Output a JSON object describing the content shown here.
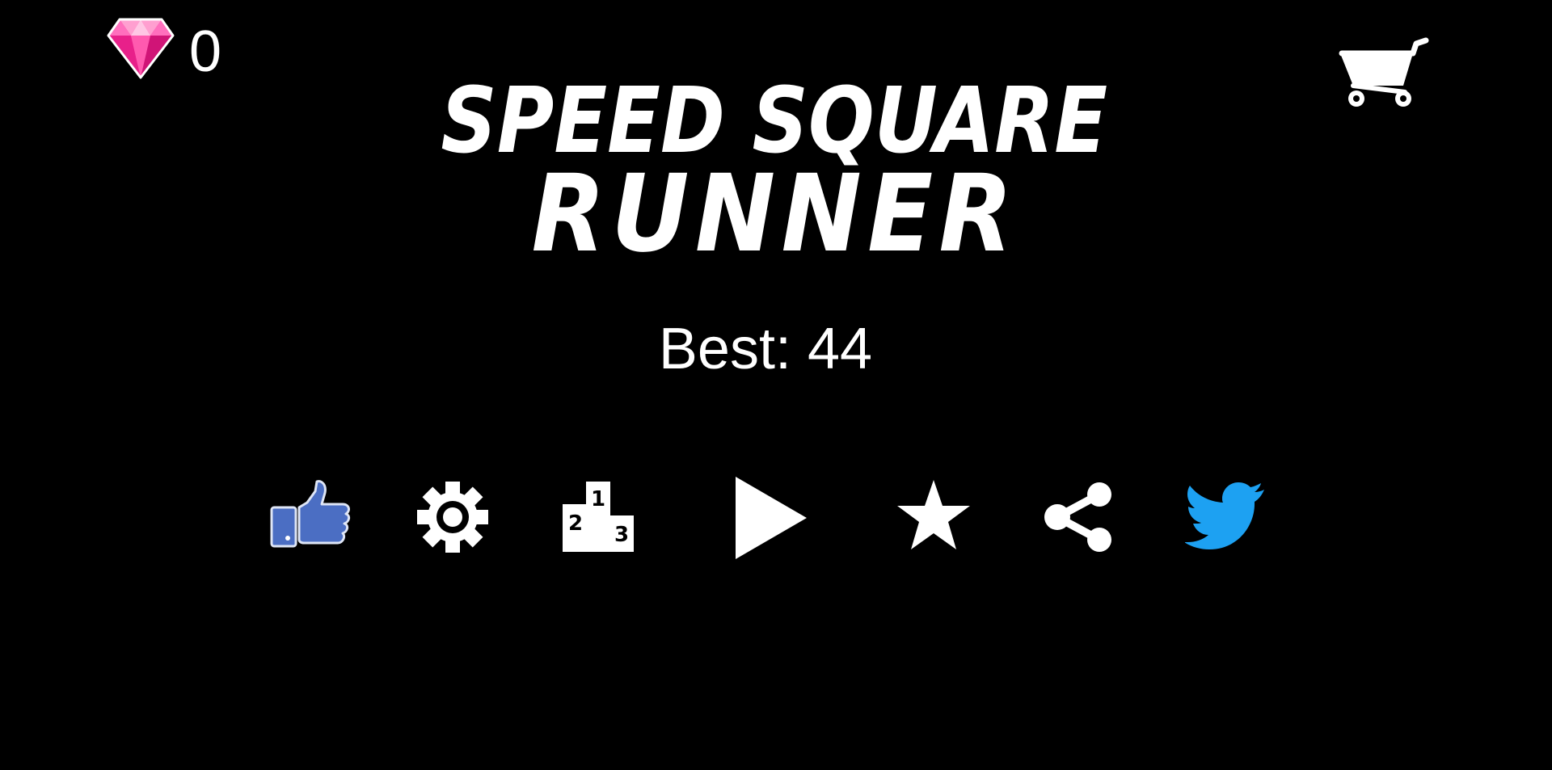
{
  "currency": {
    "gem_count": "0",
    "gem_icon": "pink-diamond-icon",
    "gem_color": "#ff3fa4"
  },
  "shop": {
    "icon": "shopping-cart-icon"
  },
  "title": {
    "line1": "SPEED SQUARE",
    "line2": "RUNNER"
  },
  "best_score": {
    "text": "Best: 44"
  },
  "menu_buttons": [
    {
      "name": "like-button",
      "icon": "thumbs-up-icon",
      "color": "#4b6ec3"
    },
    {
      "name": "settings-button",
      "icon": "gear-icon",
      "color": "#ffffff"
    },
    {
      "name": "leaderboard-button",
      "icon": "podium-icon",
      "color": "#ffffff",
      "labels": [
        "1",
        "2",
        "3"
      ]
    },
    {
      "name": "play-button",
      "icon": "play-icon",
      "color": "#ffffff"
    },
    {
      "name": "rate-button",
      "icon": "star-icon",
      "color": "#ffffff"
    },
    {
      "name": "share-button",
      "icon": "share-icon",
      "color": "#ffffff"
    },
    {
      "name": "twitter-button",
      "icon": "twitter-bird-icon",
      "color": "#1da1f2"
    }
  ]
}
